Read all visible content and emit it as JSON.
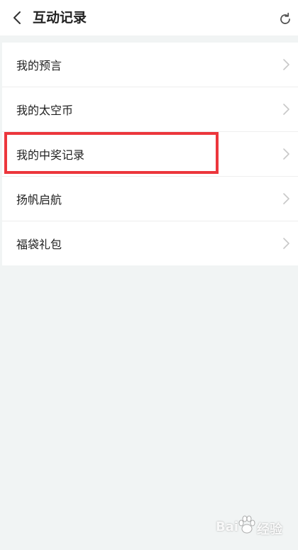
{
  "header": {
    "title": "互动记录",
    "back_icon": "chevron-left-icon",
    "refresh_icon": "refresh-icon"
  },
  "list": {
    "items": [
      {
        "label": "我的预言"
      },
      {
        "label": "我的太空币"
      },
      {
        "label": "我的中奖记录"
      },
      {
        "label": "扬帆启航"
      },
      {
        "label": "福袋礼包"
      }
    ]
  },
  "highlight": {
    "target": "我的中奖记录",
    "color": "#ec363c"
  },
  "watermark": {
    "brand_left": "Bai",
    "brand_right": "经验"
  },
  "colors": {
    "background": "#f1f4f4",
    "surface": "#ffffff",
    "text": "#222222",
    "chevron": "#c8c8c8",
    "divider": "#eeeeee"
  }
}
